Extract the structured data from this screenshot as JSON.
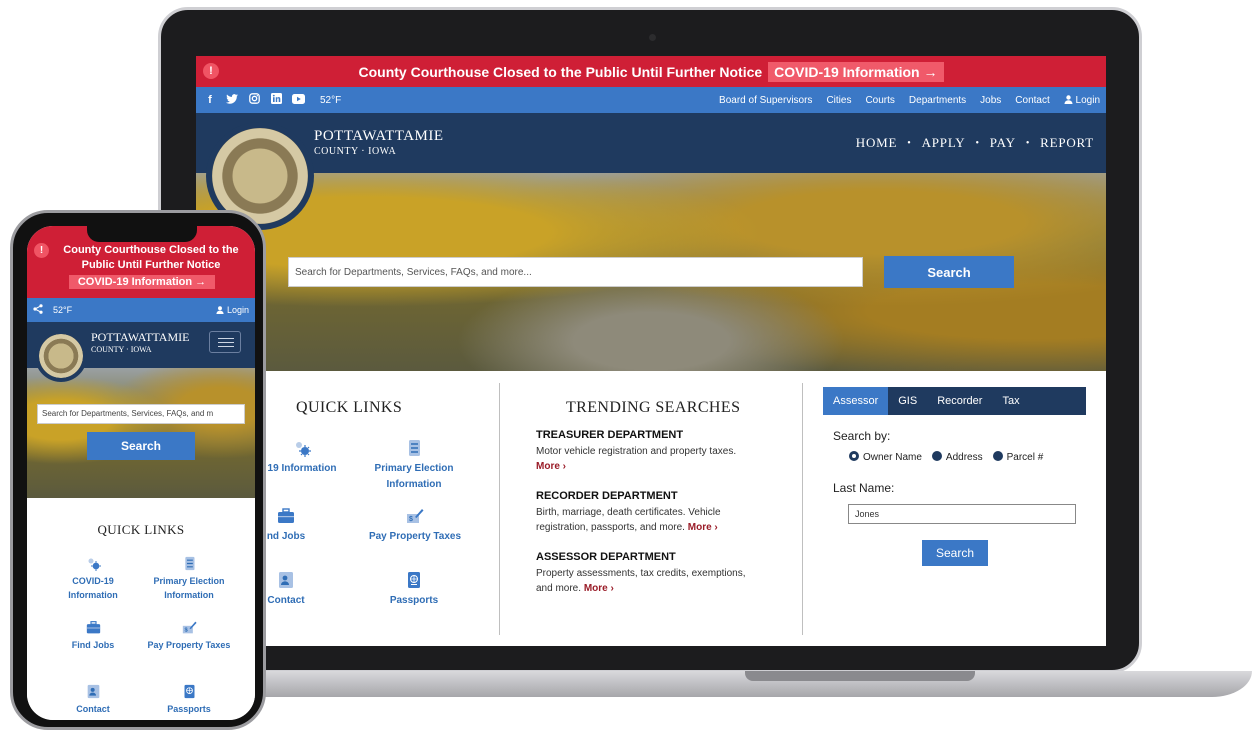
{
  "alert": {
    "message": "County Courthouse Closed to the Public Until Further Notice",
    "link_label": "COVID-19 Information →",
    "icon": "alert-circle-icon",
    "mobile_line1": "County Courthouse Closed to the",
    "mobile_line2": "Public Until Further Notice"
  },
  "utility": {
    "socials": [
      "facebook-icon",
      "twitter-icon",
      "instagram-icon",
      "linkedin-icon",
      "youtube-icon"
    ],
    "temperature": "52°F",
    "nav": [
      "Board of Supervisors",
      "Cities",
      "Courts",
      "Departments",
      "Jobs",
      "Contact"
    ],
    "login": "Login"
  },
  "header": {
    "title": "POTTAWATTAMIE",
    "subtitle": "COUNTY · IOWA",
    "main_nav": [
      "HOME",
      "APPLY",
      "PAY",
      "REPORT"
    ]
  },
  "hero": {
    "search_placeholder": "Search for Departments, Services, FAQs, and more...",
    "mobile_search_placeholder": "Search for Departments, Services, FAQs, and m",
    "search_button": "Search"
  },
  "quick_links": {
    "heading": "QUICK LINKS",
    "laptop_items": [
      {
        "label": "19 Information",
        "icon": "virus-icon"
      },
      {
        "label": "Primary Election Information",
        "icon": "ballot-icon"
      },
      {
        "label": "nd Jobs",
        "icon": "briefcase-icon"
      },
      {
        "label": "Pay Property Taxes",
        "icon": "money-icon"
      },
      {
        "label": "Contact",
        "icon": "contact-card-icon"
      },
      {
        "label": "Passports",
        "icon": "passport-icon"
      }
    ],
    "mobile_items": [
      {
        "label": "COVID-19 Information",
        "icon": "virus-icon"
      },
      {
        "label": "Primary Election Information",
        "icon": "ballot-icon"
      },
      {
        "label": "Find Jobs",
        "icon": "briefcase-icon"
      },
      {
        "label": "Pay Property Taxes",
        "icon": "money-icon"
      },
      {
        "label": "Contact",
        "icon": "contact-card-icon"
      },
      {
        "label": "Passports",
        "icon": "passport-icon"
      }
    ]
  },
  "trending": {
    "heading": "TRENDING SEARCHES",
    "items": [
      {
        "title": "TREASURER DEPARTMENT",
        "desc": "Motor vehicle registration and property taxes.",
        "more": "More ›"
      },
      {
        "title": "RECORDER DEPARTMENT",
        "desc": "Birth, marriage, death certificates. Vehicle registration, passports, and more.",
        "more": "More ›"
      },
      {
        "title": "ASSESSOR DEPARTMENT",
        "desc": "Property assessments, tax credits, exemptions, and more.",
        "more": "More ›"
      }
    ]
  },
  "property_search": {
    "tabs": [
      "Assessor",
      "GIS",
      "Recorder",
      "Tax"
    ],
    "active_tab": "Assessor",
    "search_by_label": "Search by:",
    "options": [
      "Owner Name",
      "Address",
      "Parcel #"
    ],
    "selected_option": "Owner Name",
    "last_name_label": "Last Name:",
    "last_name_value": "Jones",
    "button": "Search"
  },
  "colors": {
    "alert_red": "#cf1f36",
    "utility_blue": "#3b78c6",
    "header_navy": "#1f3a5f",
    "more_link": "#9a1c28"
  }
}
